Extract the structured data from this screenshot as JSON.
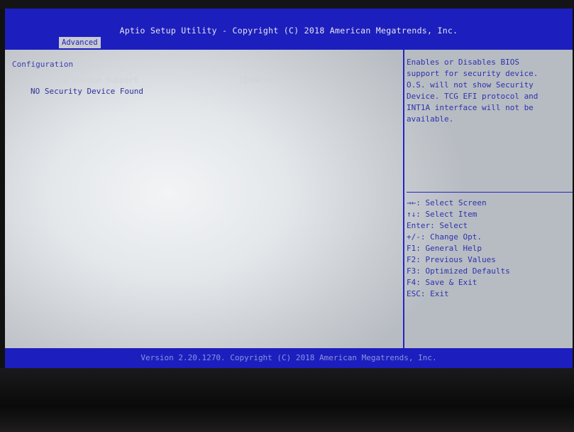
{
  "header": {
    "title": "Aptio Setup Utility - Copyright (C) 2018 American Megatrends, Inc.",
    "active_tab": "Advanced"
  },
  "main": {
    "section_title": "Configuration",
    "rows": [
      {
        "label": "Security Device Support",
        "value": "[Enable]"
      },
      {
        "label": "NO Security Device Found",
        "value": ""
      }
    ]
  },
  "help": {
    "description": "Enables or Disables BIOS\nsupport for security device.\nO.S. will not show Security\nDevice. TCG EFI protocol and\nINT1A interface will not be\navailable.",
    "keys": [
      "→←: Select Screen",
      "↑↓: Select Item",
      "Enter: Select",
      "+/-: Change Opt.",
      "F1: General Help",
      "F2: Previous Values",
      "F3: Optimized Defaults",
      "F4: Save & Exit",
      "ESC: Exit"
    ]
  },
  "footer": {
    "text": "Version 2.20.1270. Copyright (C) 2018 American Megatrends, Inc."
  }
}
